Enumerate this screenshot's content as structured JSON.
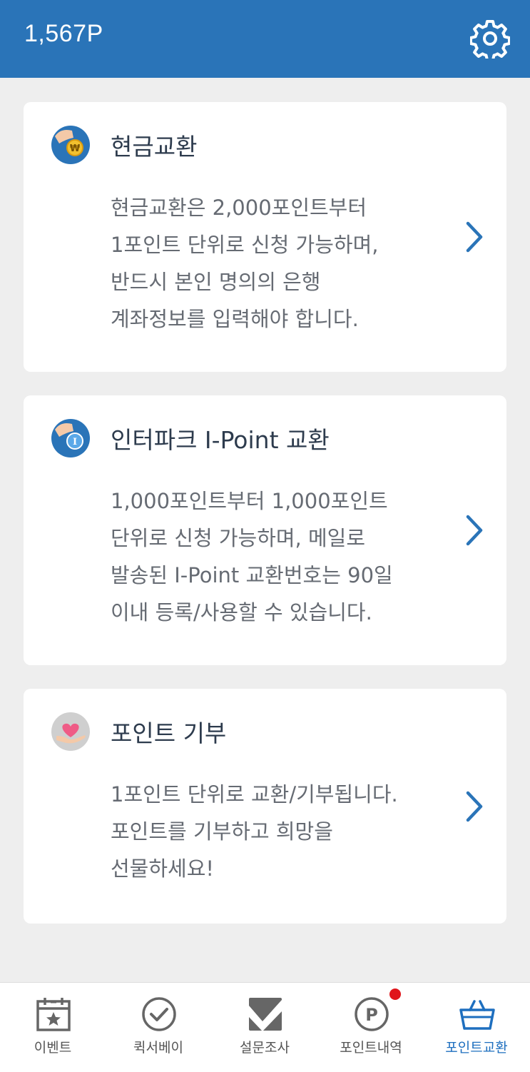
{
  "header": {
    "points": "1,567P",
    "settings_icon": "gear-icon"
  },
  "cards": [
    {
      "icon": "cash-coin-icon",
      "title": "현금교환",
      "lines": [
        "현금교환은 2,000포인트부터",
        "1포인트 단위로 신청 가능하며,",
        "반드시 본인 명의의 은행",
        "계좌정보를 입력해야 합니다."
      ],
      "coin_glyph": "₩"
    },
    {
      "icon": "ipoint-coin-icon",
      "title": "인터파크 I-Point 교환",
      "lines": [
        "1,000포인트부터 1,000포인트",
        "단위로 신청 가능하며, 메일로",
        "발송된 I-Point 교환번호는 90일",
        "이내 등록/사용할 수 있습니다."
      ],
      "coin_glyph": "I"
    },
    {
      "icon": "heart-hand-icon",
      "title": "포인트 기부",
      "lines": [
        "1포인트 단위로 교환/기부됩니다.",
        "포인트를 기부하고 희망을",
        "선물하세요!"
      ]
    }
  ],
  "tabs": [
    {
      "label": "이벤트",
      "icon": "calendar-star-icon",
      "active": false
    },
    {
      "label": "퀵서베이",
      "icon": "check-circle-icon",
      "active": false
    },
    {
      "label": "설문조사",
      "icon": "checkbox-icon",
      "active": false
    },
    {
      "label": "포인트내역",
      "icon": "point-p-icon",
      "active": false,
      "badge": true
    },
    {
      "label": "포인트교환",
      "icon": "basket-icon",
      "active": true
    }
  ],
  "colors": {
    "primary": "#2a74b8",
    "active_tab": "#1e6fbf",
    "badge": "#e0151b"
  }
}
